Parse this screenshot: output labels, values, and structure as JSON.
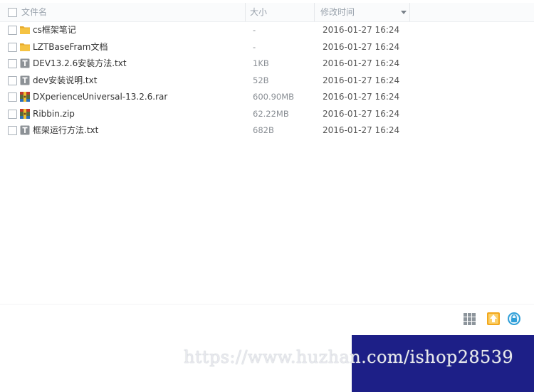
{
  "header": {
    "name_label": "文件名",
    "size_label": "大小",
    "time_label": "修改时间"
  },
  "files": [
    {
      "name": "cs框架笔记",
      "type": "folder-icon",
      "size": "-",
      "modified": "2016-01-27 16:24"
    },
    {
      "name": "LZTBaseFram文档",
      "type": "folder-icon",
      "size": "-",
      "modified": "2016-01-27 16:24"
    },
    {
      "name": "DEV13.2.6安装方法.txt",
      "type": "text-file-icon",
      "size": "1KB",
      "modified": "2016-01-27 16:24"
    },
    {
      "name": "dev安装说明.txt",
      "type": "text-file-icon",
      "size": "52B",
      "modified": "2016-01-27 16:24"
    },
    {
      "name": "DXperienceUniversal-13.2.6.rar",
      "type": "archive-icon",
      "size": "600.90MB",
      "modified": "2016-01-27 16:24"
    },
    {
      "name": "Ribbin.zip",
      "type": "archive-icon",
      "size": "62.22MB",
      "modified": "2016-01-27 16:24"
    },
    {
      "name": "框架运行方法.txt",
      "type": "text-file-icon",
      "size": "682B",
      "modified": "2016-01-27 16:24"
    }
  ],
  "toolbar": {
    "grid_icon": "grid-view-icon",
    "upload_icon": "upload-icon",
    "lock_icon": "lock-icon"
  },
  "watermark": {
    "text": "https://www.huzhan.com/ishop28539"
  },
  "colors": {
    "folder": "#f5c343",
    "text_file": "#8c9196",
    "watermark_bg": "#1d1f87",
    "upload_accent": "#f2a81d",
    "lock_accent": "#2f9fd8"
  }
}
